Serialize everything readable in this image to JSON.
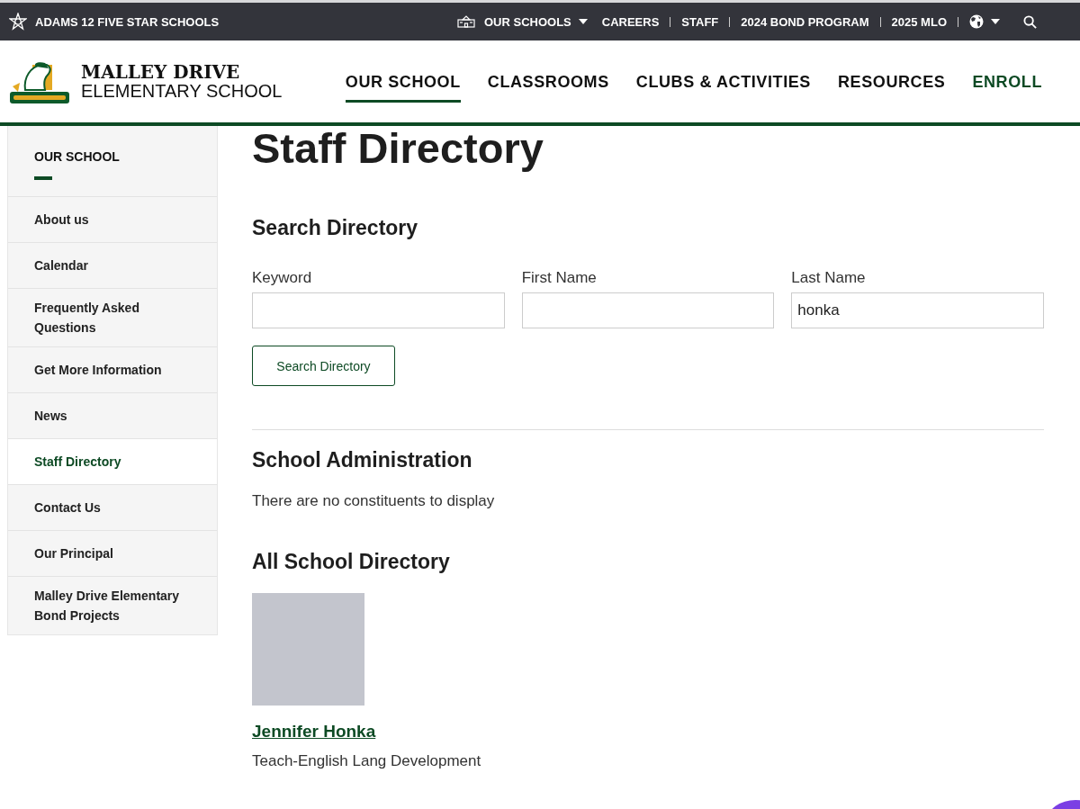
{
  "top_bar": {
    "district": "ADAMS 12 FIVE STAR SCHOOLS",
    "links": [
      {
        "label": "OUR SCHOOLS",
        "kind": "dropdown"
      },
      {
        "label": "CAREERS",
        "kind": "link"
      },
      {
        "label": "STAFF",
        "kind": "link"
      },
      {
        "label": "2024 BOND PROGRAM",
        "kind": "link"
      },
      {
        "label": "2025 MLO",
        "kind": "link"
      }
    ]
  },
  "header": {
    "school_name": "MALLEY DRIVE",
    "school_type": "ELEMENTARY SCHOOL",
    "nav": [
      {
        "label": "OUR SCHOOL",
        "selected": true,
        "kind": "menu"
      },
      {
        "label": "CLASSROOMS",
        "selected": false,
        "kind": "menu"
      },
      {
        "label": "CLUBS & ACTIVITIES",
        "selected": false,
        "kind": "menu"
      },
      {
        "label": "RESOURCES",
        "selected": false,
        "kind": "menu"
      },
      {
        "label": "ENROLL",
        "selected": false,
        "kind": "cta"
      }
    ]
  },
  "sidebar": {
    "title": "OUR SCHOOL",
    "items": [
      {
        "label": "About us",
        "selected": false
      },
      {
        "label": "Calendar",
        "selected": false
      },
      {
        "label": "Frequently Asked Questions",
        "selected": false
      },
      {
        "label": "Get More Information",
        "selected": false
      },
      {
        "label": "News",
        "selected": false
      },
      {
        "label": "Staff Directory",
        "selected": true
      },
      {
        "label": "Contact Us",
        "selected": false
      },
      {
        "label": "Our Principal",
        "selected": false
      },
      {
        "label": "Malley Drive Elementary Bond Projects",
        "selected": false
      }
    ]
  },
  "page_title": "Staff Directory",
  "search": {
    "heading": "Search Directory",
    "fields": [
      {
        "label": "Keyword"
      },
      {
        "label": "First Name"
      },
      {
        "label": "Last Name",
        "value": "honka"
      }
    ],
    "button": "Search Directory"
  },
  "administration": {
    "heading": "School Administration",
    "message": "There are no constituents to display"
  },
  "directory": {
    "heading": "All School Directory",
    "people": [
      {
        "name": "Jennifer Honka",
        "title": "Teach-English Lang Development"
      }
    ]
  }
}
